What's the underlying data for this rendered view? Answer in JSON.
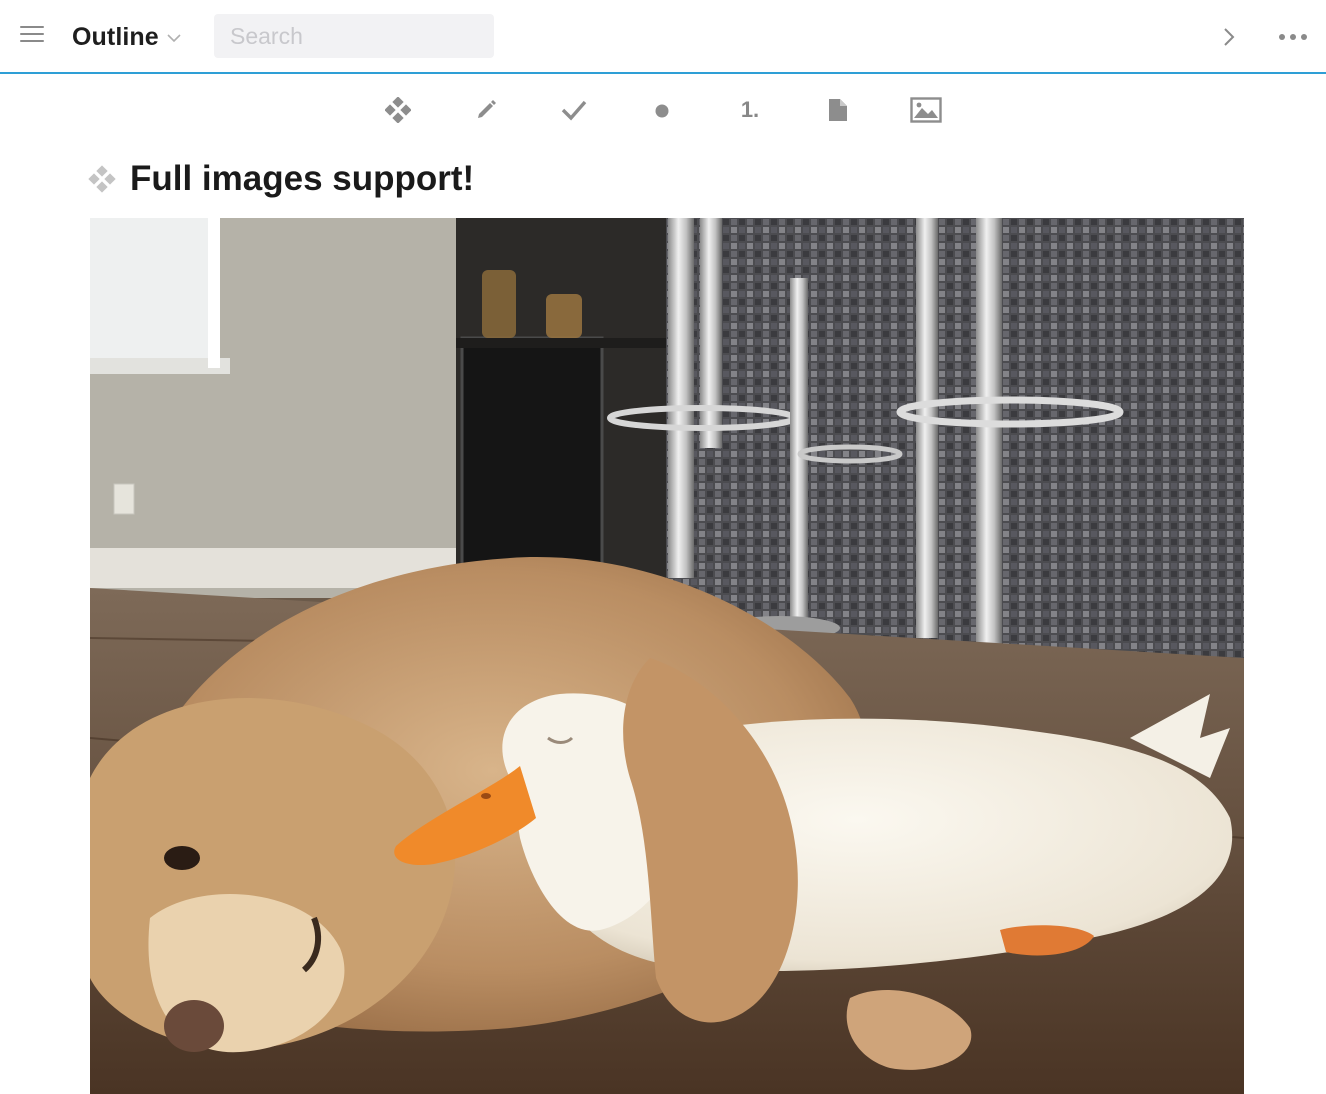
{
  "header": {
    "title": "Outline",
    "search_placeholder": "Search",
    "icons": {
      "menu": "hamburger-menu-icon",
      "title_dropdown": "chevron-down-icon",
      "forward": "chevron-right-icon",
      "more": "ellipsis-icon"
    },
    "accent_color": "#2e9fd6"
  },
  "toolbar": {
    "items": [
      {
        "name": "heading",
        "icon": "diamond-bullet-icon"
      },
      {
        "name": "note",
        "icon": "pencil-icon"
      },
      {
        "name": "task",
        "icon": "checkmark-icon"
      },
      {
        "name": "bullet",
        "icon": "dot-icon"
      },
      {
        "name": "numbered",
        "label": "1."
      },
      {
        "name": "file",
        "icon": "document-icon"
      },
      {
        "name": "image",
        "icon": "image-icon"
      }
    ]
  },
  "content": {
    "heading": "Full images support!",
    "image": {
      "subject": "golden retriever dog lying on a wooden floor hugging a white duck"
    }
  }
}
